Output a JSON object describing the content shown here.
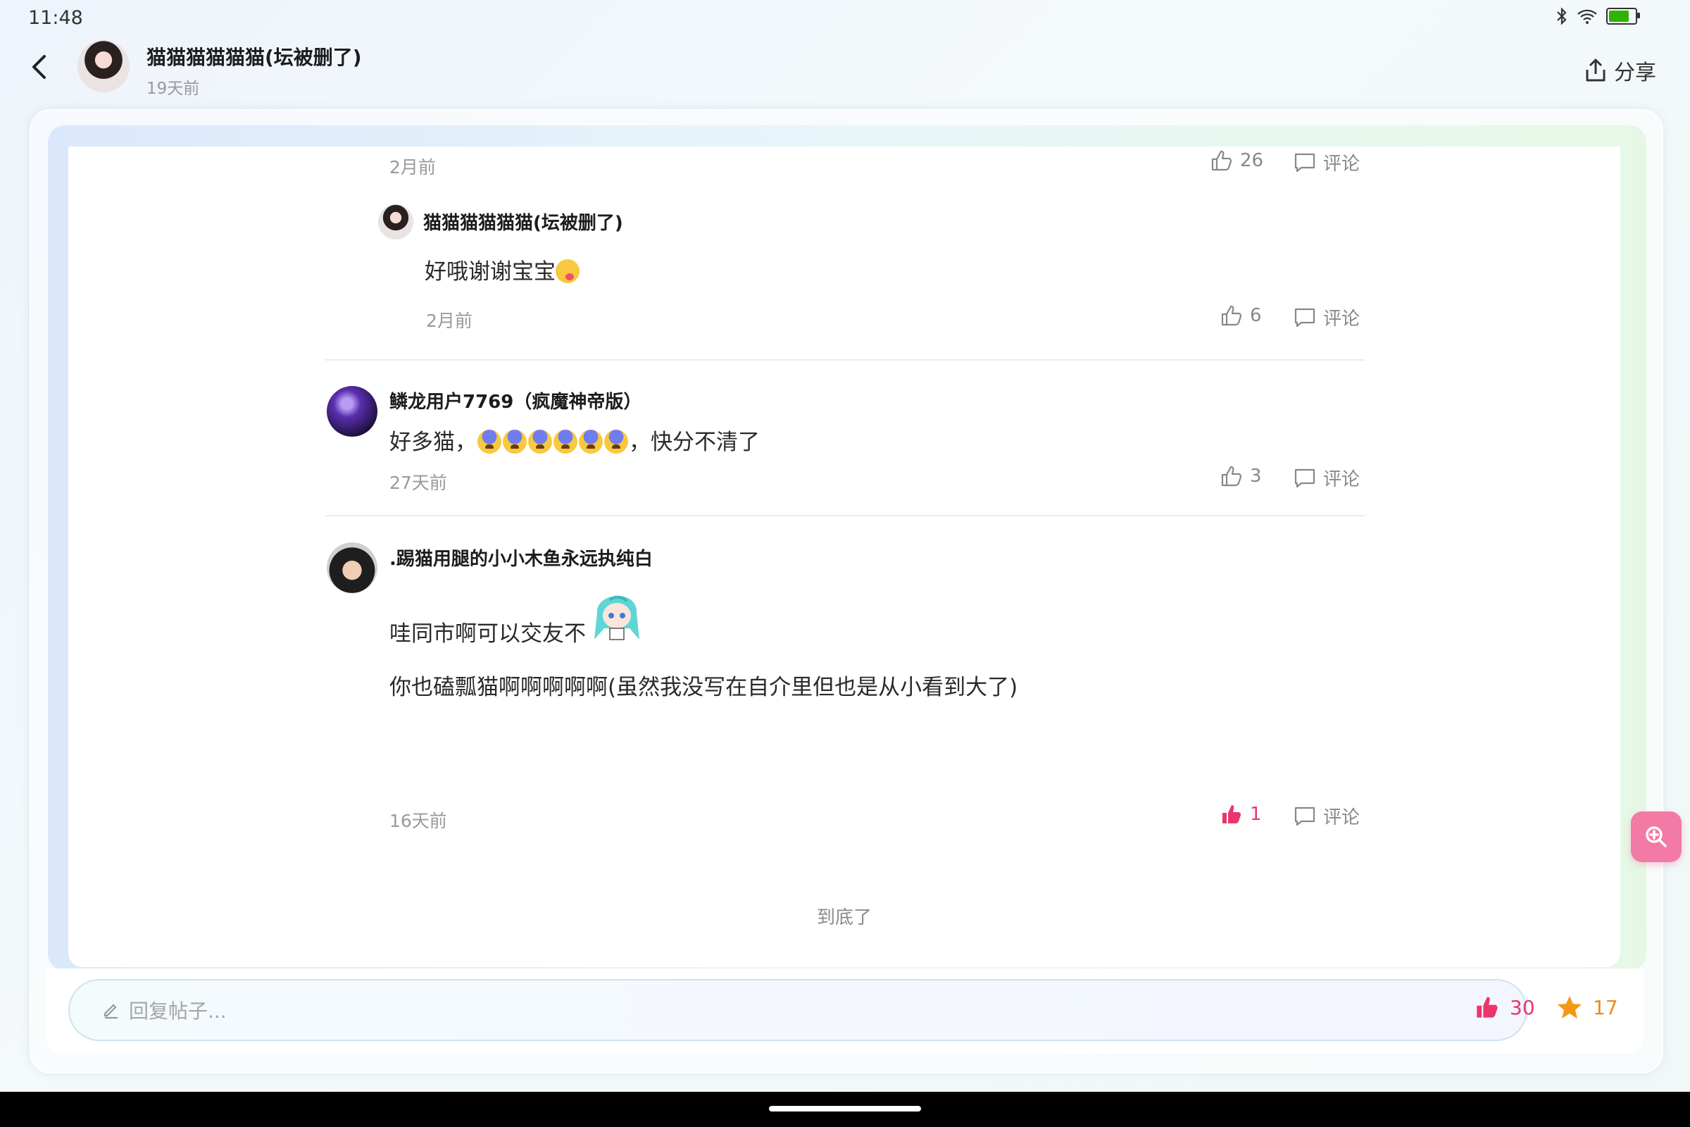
{
  "status_bar": {
    "time": "11:48"
  },
  "header": {
    "title": "猫猫猫猫猫猫(坛被删了)",
    "time": "19天前",
    "share_label": "分享"
  },
  "comments": [
    {
      "kind": "partial",
      "time": "2月前",
      "likes": "26",
      "comment_label": "评论"
    },
    {
      "kind": "reply",
      "author": "猫猫猫猫猫猫(坛被删了)",
      "text": "好哦谢谢宝宝",
      "time": "2月前",
      "likes": "6",
      "comment_label": "评论"
    },
    {
      "kind": "top",
      "author": "鳞龙用户7769（疯魔神帝版）",
      "text_before": "好多猫，",
      "text_after": "，快分不清了",
      "time": "27天前",
      "likes": "3",
      "comment_label": "评论"
    },
    {
      "kind": "top",
      "author": ".踢猫用腿的小小木鱼永远执纯白",
      "line1": "哇同市啊可以交友不",
      "line2": "你也磕瓢猫啊啊啊啊啊(虽然我没写在自介里但也是从小看到大了)",
      "time": "16天前",
      "likes": "1",
      "comment_label": "评论",
      "liked": true
    }
  ],
  "end_text": "到底了",
  "reply_bar": {
    "placeholder": "回复帖子...",
    "like_count": "30",
    "favorite_count": "17"
  },
  "colors": {
    "liked": "#e9366b",
    "favorite": "#f08a17",
    "zoom_button": "#f27aa4"
  },
  "icons": [
    "back-arrow-icon",
    "share-icon",
    "thumb-up-icon",
    "comment-bubble-icon",
    "pencil-icon",
    "star-icon",
    "zoom-in-icon"
  ]
}
